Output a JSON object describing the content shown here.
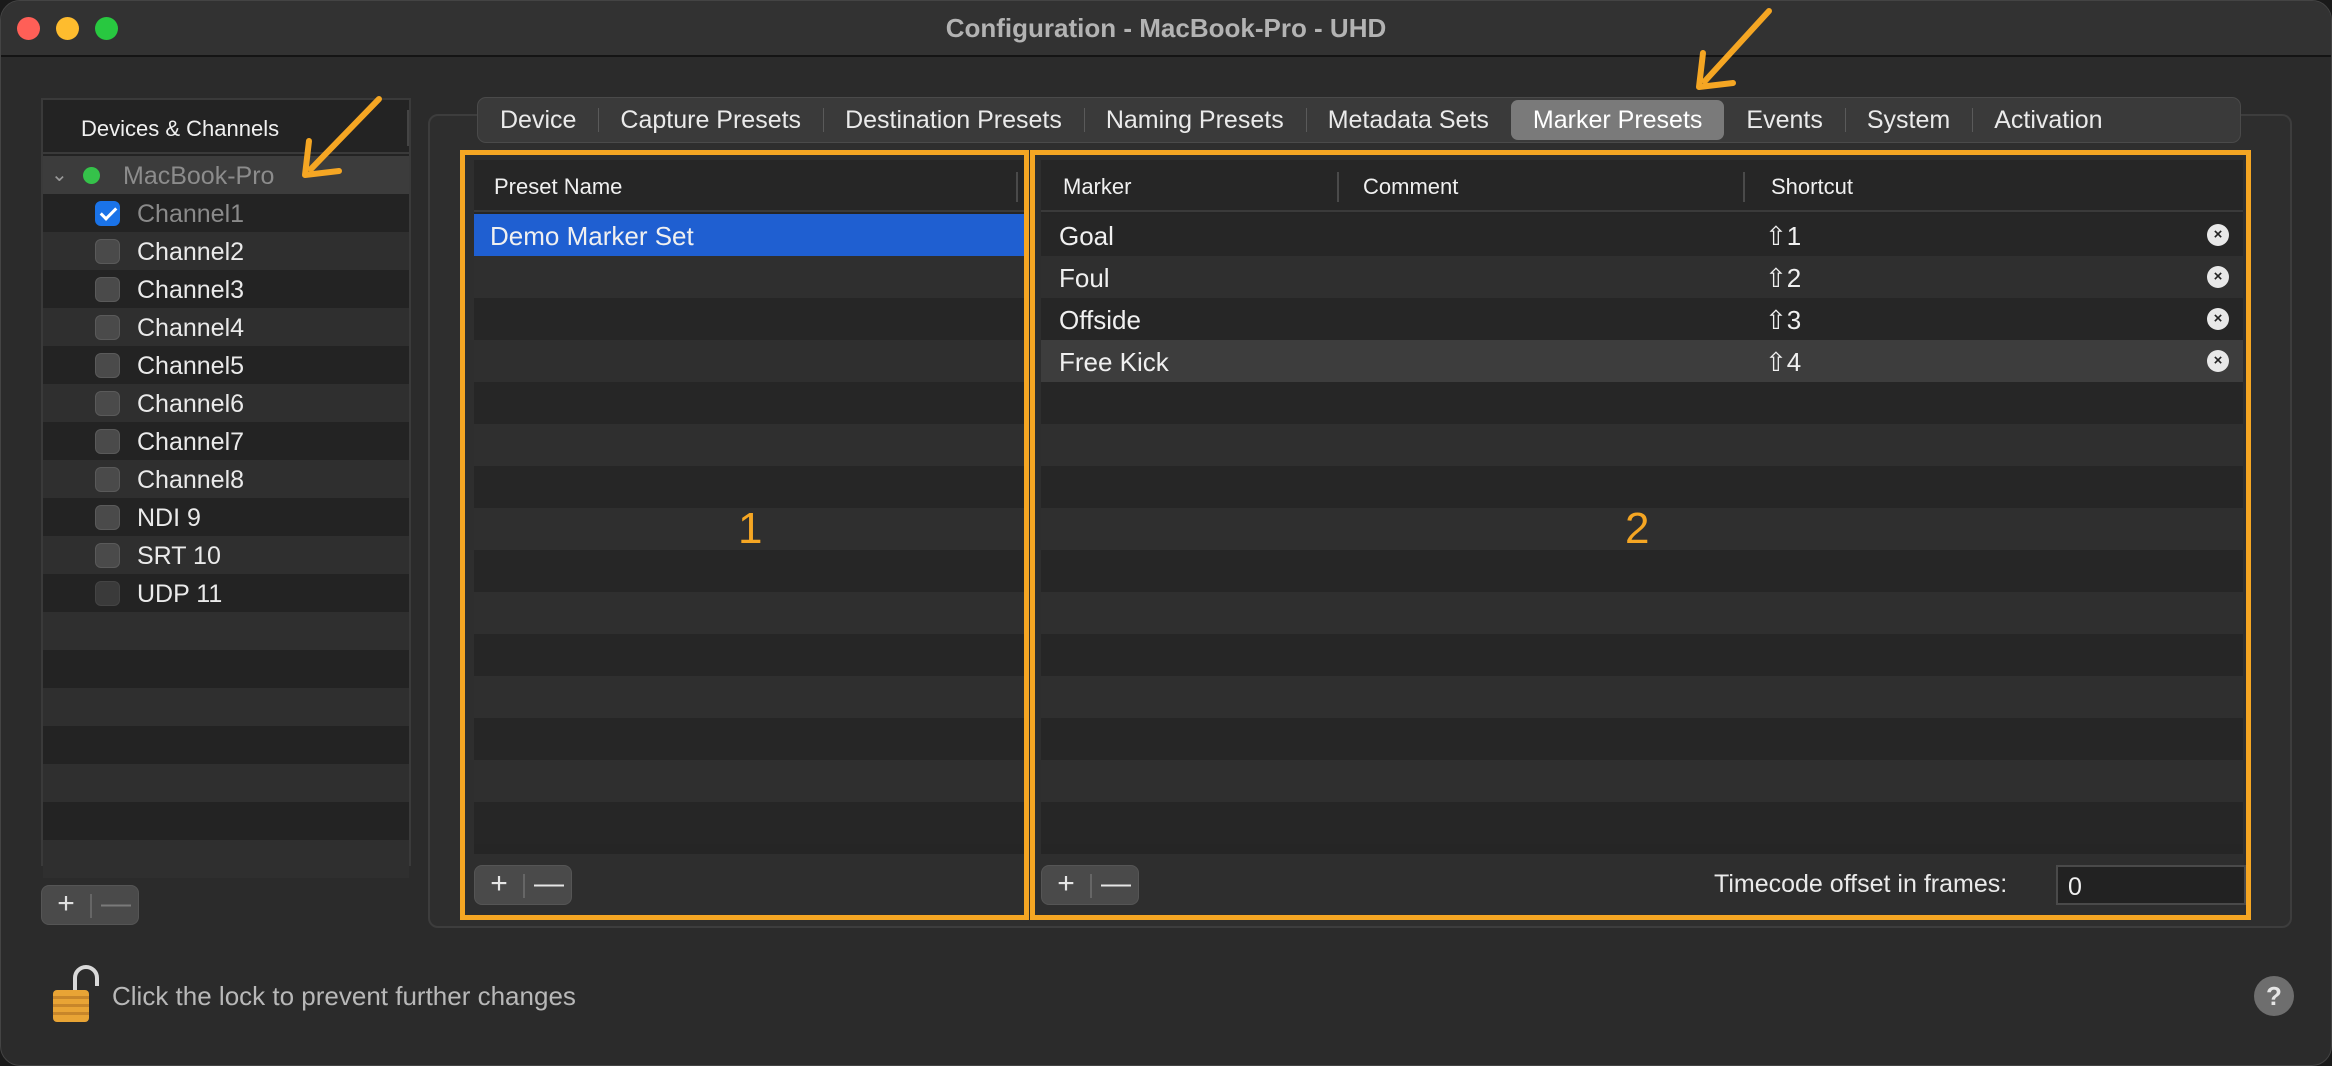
{
  "window": {
    "title": "Configuration - MacBook-Pro - UHD"
  },
  "sidebar": {
    "header": "Devices & Channels",
    "device": "MacBook-Pro",
    "channels": [
      {
        "label": "Channel1",
        "checked": true
      },
      {
        "label": "Channel2",
        "checked": false
      },
      {
        "label": "Channel3",
        "checked": false
      },
      {
        "label": "Channel4",
        "checked": false
      },
      {
        "label": "Channel5",
        "checked": false
      },
      {
        "label": "Channel6",
        "checked": false
      },
      {
        "label": "Channel7",
        "checked": false
      },
      {
        "label": "Channel8",
        "checked": false
      },
      {
        "label": "NDI 9",
        "checked": false
      },
      {
        "label": "SRT 10",
        "checked": false
      },
      {
        "label": "UDP 11",
        "checked": false
      }
    ],
    "add_label": "+",
    "remove_label": "—"
  },
  "tabs": [
    "Device",
    "Capture Presets",
    "Destination Presets",
    "Naming Presets",
    "Metadata Sets",
    "Marker Presets",
    "Events",
    "System",
    "Activation"
  ],
  "active_tab": "Marker Presets",
  "presets_table": {
    "header": "Preset Name",
    "rows": [
      "Demo Marker Set"
    ],
    "add_label": "+",
    "remove_label": "—"
  },
  "markers_table": {
    "headers": {
      "marker": "Marker",
      "comment": "Comment",
      "shortcut": "Shortcut"
    },
    "rows": [
      {
        "marker": "Goal",
        "comment": "",
        "shortcut": "⇧1"
      },
      {
        "marker": "Foul",
        "comment": "",
        "shortcut": "⇧2"
      },
      {
        "marker": "Offside",
        "comment": "",
        "shortcut": "⇧3"
      },
      {
        "marker": "Free Kick",
        "comment": "",
        "shortcut": "⇧4"
      }
    ],
    "remove_icon": "×",
    "add_label": "+",
    "remove_label": "—"
  },
  "timecode": {
    "label": "Timecode offset in frames:",
    "value": "0"
  },
  "annotations": {
    "box1": "1",
    "box2": "2",
    "color": "#f5a623"
  },
  "footer": {
    "lock_text": "Click the lock to prevent further changes",
    "help_label": "?"
  }
}
